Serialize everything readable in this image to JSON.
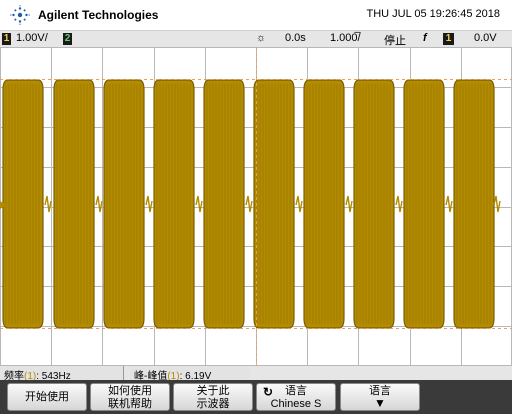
{
  "header": {
    "brand": "Agilent Technologies",
    "datetime": "THU JUL 05 19:26:45 2018"
  },
  "status": {
    "ch1_label": "1",
    "ch1_scale": "1.00V/",
    "ch2_label": "2",
    "time_position": "0.0s",
    "time_scale": "1.000̅/",
    "run_state": "停止",
    "trigger_slope": "f",
    "trigger_source": "1",
    "trigger_level": "0.0V"
  },
  "measurements": {
    "freq_label": "频率",
    "freq_channel": "(1)",
    "freq_value": ": 543Hz",
    "pk_label": "峰-峰值",
    "pk_channel": "(1)",
    "pk_value": ": 6.19V"
  },
  "softkeys": {
    "k1": "开始使用",
    "k2_line1": "如何使用",
    "k2_line2": "联机帮助",
    "k3_line1": "关于此",
    "k3_line2": "示波器",
    "k4_line1": "语言",
    "k4_line2": "Chinese S",
    "k5_line1": "语言"
  },
  "colors": {
    "trace": "#b38b00",
    "trace_dark": "#7a5e00",
    "grid": "#b8b8b8",
    "marker": "#e8a060"
  },
  "icons": {
    "logo": "agilent-spark-icon",
    "trigger": "sun-trigger-icon",
    "lang": "swirl-arrow-icon",
    "down": "down-arrow-icon"
  }
}
